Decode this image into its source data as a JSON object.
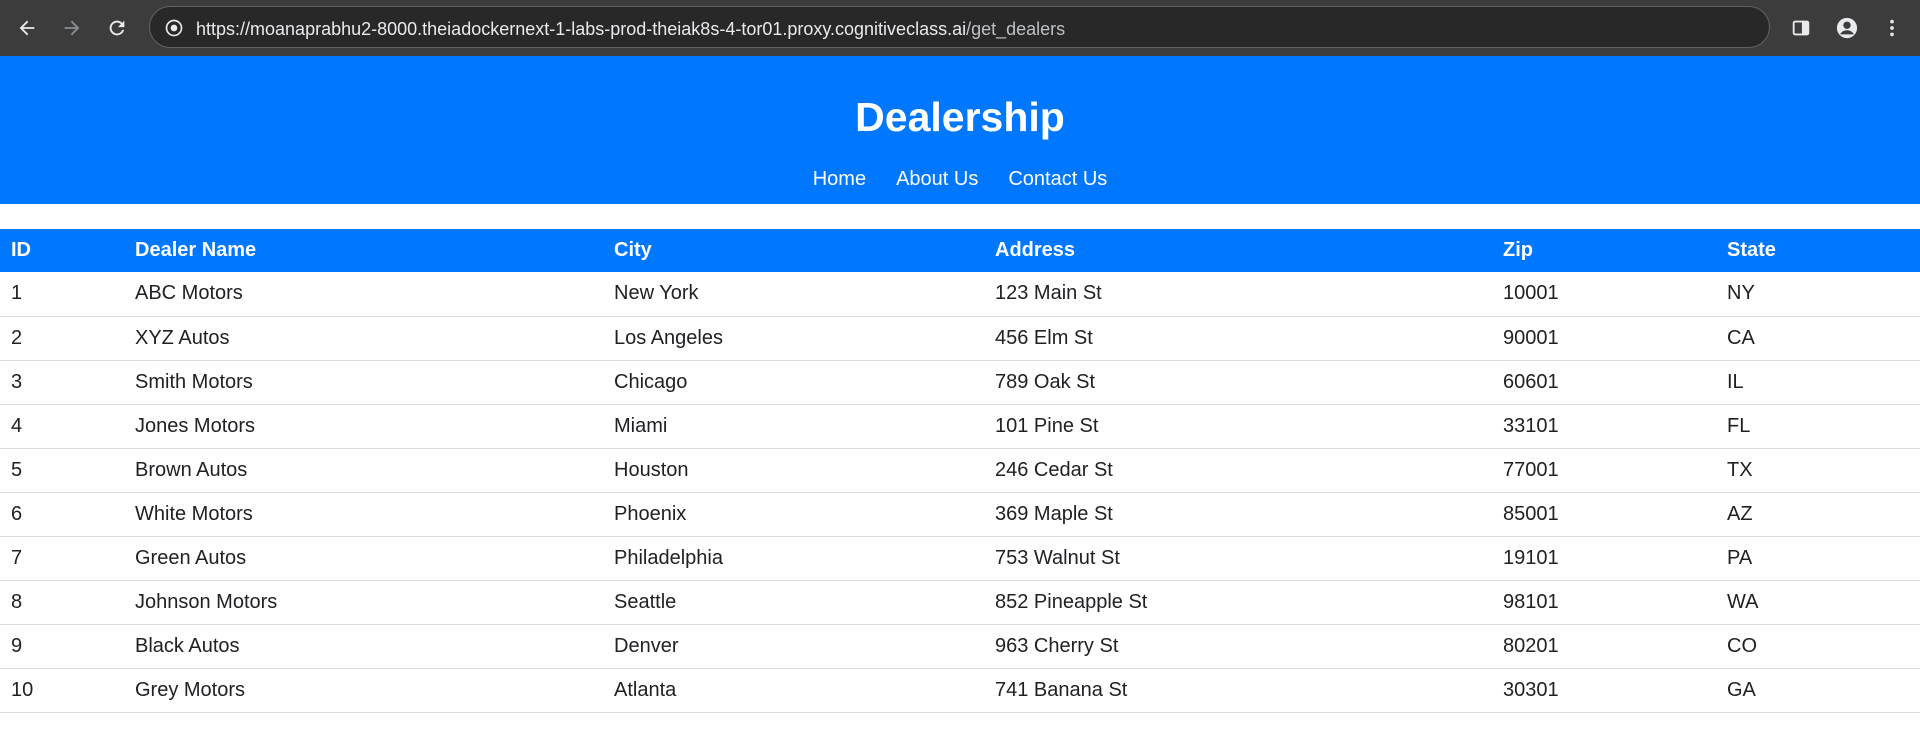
{
  "browser": {
    "url_main": "https://moanaprabhu2-8000.theiadockernext-1-labs-prod-theiak8s-4-tor01.proxy.cognitiveclass.ai",
    "url_path": "/get_dealers",
    "icons": [
      "back-arrow-icon",
      "forward-arrow-icon",
      "reload-icon",
      "site-info-icon",
      "side-panel-icon",
      "profile-icon",
      "more-vert-icon"
    ]
  },
  "header": {
    "title": "Dealership",
    "nav": [
      "Home",
      "About Us",
      "Contact Us"
    ],
    "background": "#0077ff"
  },
  "table": {
    "columns": [
      "ID",
      "Dealer Name",
      "City",
      "Address",
      "Zip",
      "State"
    ],
    "rows": [
      [
        "1",
        "ABC Motors",
        "New York",
        "123 Main St",
        "10001",
        "NY"
      ],
      [
        "2",
        "XYZ Autos",
        "Los Angeles",
        "456 Elm St",
        "90001",
        "CA"
      ],
      [
        "3",
        "Smith Motors",
        "Chicago",
        "789 Oak St",
        "60601",
        "IL"
      ],
      [
        "4",
        "Jones Motors",
        "Miami",
        "101 Pine St",
        "33101",
        "FL"
      ],
      [
        "5",
        "Brown Autos",
        "Houston",
        "246 Cedar St",
        "77001",
        "TX"
      ],
      [
        "6",
        "White Motors",
        "Phoenix",
        "369 Maple St",
        "85001",
        "AZ"
      ],
      [
        "7",
        "Green Autos",
        "Philadelphia",
        "753 Walnut St",
        "19101",
        "PA"
      ],
      [
        "8",
        "Johnson Motors",
        "Seattle",
        "852 Pineapple St",
        "98101",
        "WA"
      ],
      [
        "9",
        "Black Autos",
        "Denver",
        "963 Cherry St",
        "80201",
        "CO"
      ],
      [
        "10",
        "Grey Motors",
        "Atlanta",
        "741 Banana St",
        "30301",
        "GA"
      ]
    ]
  }
}
